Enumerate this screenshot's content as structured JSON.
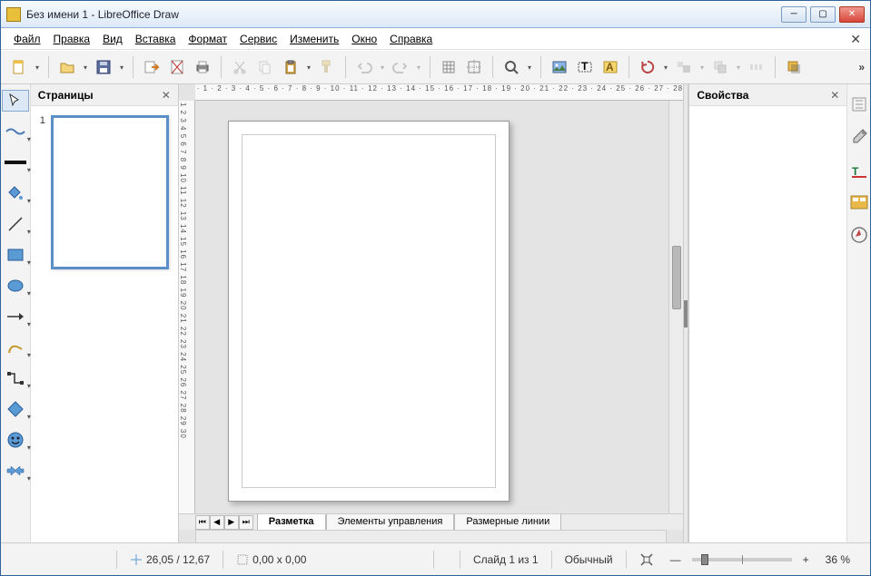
{
  "window": {
    "title": "Без имени 1 - LibreOffice Draw"
  },
  "menu": {
    "file": "Файл",
    "edit": "Правка",
    "view": "Вид",
    "insert": "Вставка",
    "format": "Формат",
    "tools": "Сервис",
    "modify": "Изменить",
    "window": "Окно",
    "help": "Справка"
  },
  "panels": {
    "pages_title": "Страницы",
    "properties_title": "Свойства",
    "page_number": "1"
  },
  "ruler_h": "· 1 · 2 · 3 · 4 · 5 · 6 · 7 · 8 · 9 · 10 · 11 · 12 · 13 · 14 · 15 · 16 · 17 · 18 · 19 · 20 · 21 · 22 · 23 · 24 · 25 · 26 · 27 · 28",
  "ruler_v": "1 2 3 4 5 6 7 8 9 10 11 12 13 14 15 16 17 18 19 20 21 22 23 24 25 26 27 28 29 30",
  "tabs": {
    "layout": "Разметка",
    "controls": "Элементы управления",
    "dimlines": "Размерные линии"
  },
  "status": {
    "cursor_pos": "26,05 / 12,67",
    "object_size": "0,00 x 0,00",
    "slide_info": "Слайд 1 из 1",
    "layout_mode": "Обычный",
    "zoom": "36 %"
  }
}
